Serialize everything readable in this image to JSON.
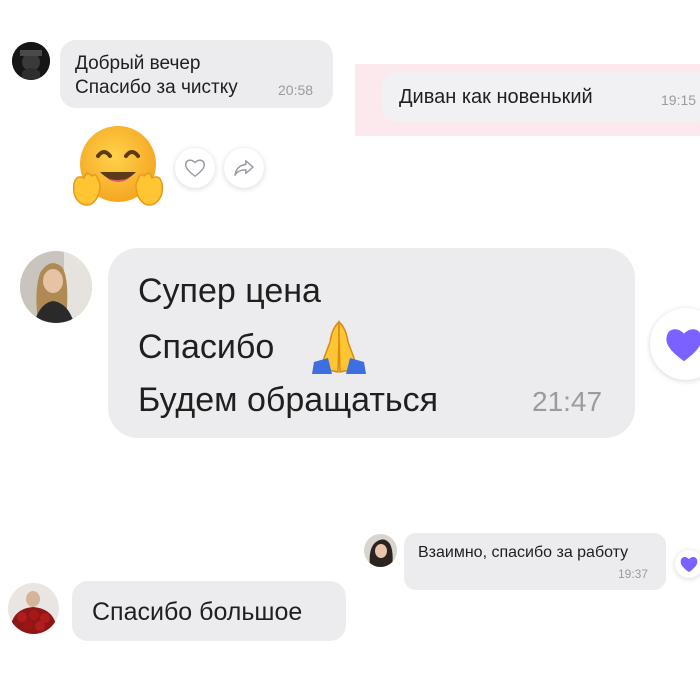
{
  "chat1": {
    "message_lines": [
      "Добрый вечер",
      "Спасибо за чистку"
    ],
    "time": "20:58"
  },
  "chat1_right": {
    "message": "Диван как новенький",
    "time": "19:15"
  },
  "reaction_row": {
    "emoji_icon": "hugging-face-icon",
    "like_icon": "heart-outline-icon",
    "share_icon": "share-arrow-icon"
  },
  "chat2": {
    "message_lines": [
      "Супер цена",
      "Спасибо",
      "Будем обращаться"
    ],
    "emoji_icon": "folded-hands-icon",
    "time": "21:47",
    "reaction_icon": "heart-filled-icon"
  },
  "chat3": {
    "message": "Взаимно, спасибо за работу",
    "time": "19:37",
    "reaction_icon": "heart-filled-icon"
  },
  "chat4": {
    "message": "Спасибо большое"
  },
  "colors": {
    "bubble": "#ececee",
    "bubble_pink": "#fbe9ee",
    "timestamp": "#9a9aa0",
    "heart_accent": "#7b61ff"
  }
}
